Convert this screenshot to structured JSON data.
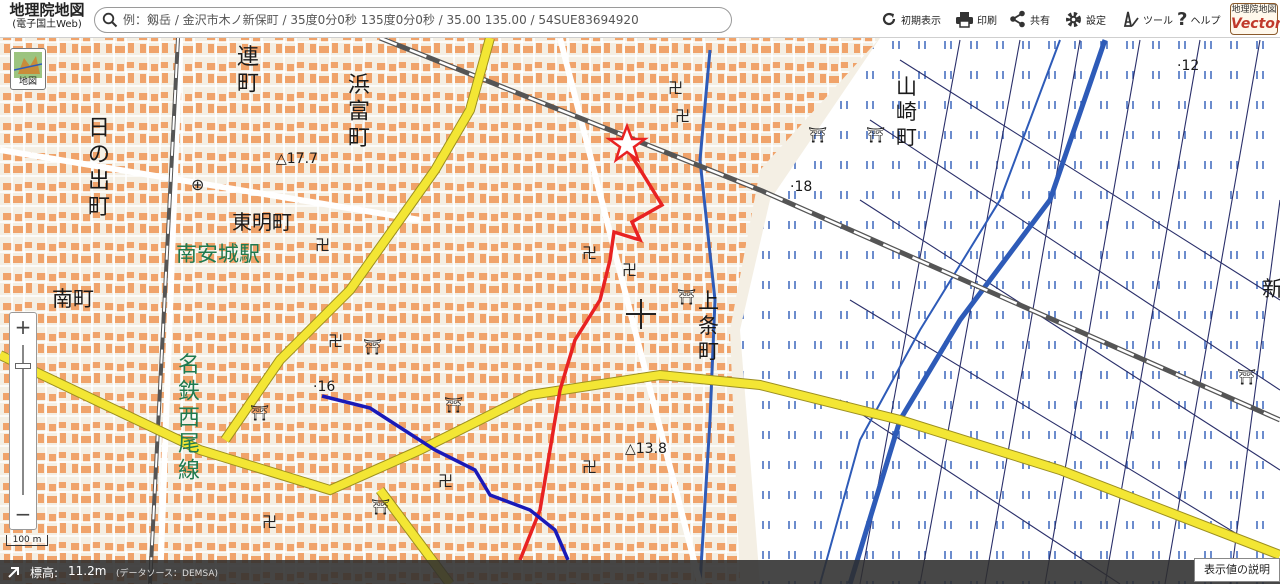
{
  "app": {
    "title": "地理院地図",
    "subtitle": "(電子国土Web)"
  },
  "search": {
    "placeholder": "例：剱岳 / 金沢市木ノ新保町 / 35度0分0秒 135度0分0秒 / 35.00 135.00 / 54SUE83694920"
  },
  "toolbar": {
    "reset_label": "初期表示",
    "print_label": "印刷",
    "share_label": "共有",
    "settings_label": "設定",
    "tools_label": "ツール",
    "help_label": "ヘルプ"
  },
  "vector_badge": {
    "top": "地理院地図",
    "bottom": "Vector"
  },
  "layer_button": {
    "label": "地図"
  },
  "zoom": {
    "in": "+",
    "out": "−"
  },
  "scale": {
    "label": "100 m"
  },
  "footer": {
    "elevation_label": "標高:",
    "elevation_value": "11.2m",
    "elevation_source": "(データソース：DEMSA)",
    "legend_button": "表示値の説明"
  },
  "map": {
    "place_names": {
      "muraji": "連\n町",
      "hamatomi": "浜\n富\n町",
      "hinode": "日\nの\n出\n町",
      "tomei": "東明町",
      "station": "南安城駅",
      "minami": "南町",
      "meitetsu": "名\n鉄\n西\n尾\n線",
      "kamijo": "上\n条\n町",
      "yamazaki": "山\n崎\n町",
      "shin": "新"
    },
    "spot_heights": {
      "h177": "△17.7",
      "h18": "·18",
      "h12": "·12",
      "h16": "·16",
      "h138": "△13.8"
    },
    "colors": {
      "background": "#f4efe4",
      "building": "#f0a36a",
      "road": "#ffffff",
      "road_outline": "#c8c0b0",
      "highway": "#f3e634",
      "railway": "#555555",
      "water": "#2e5bb8",
      "route_red": "#e82222",
      "route_blue": "#1a1ab8",
      "station_label": "#1f7a4f",
      "symbol": "#222222"
    }
  }
}
